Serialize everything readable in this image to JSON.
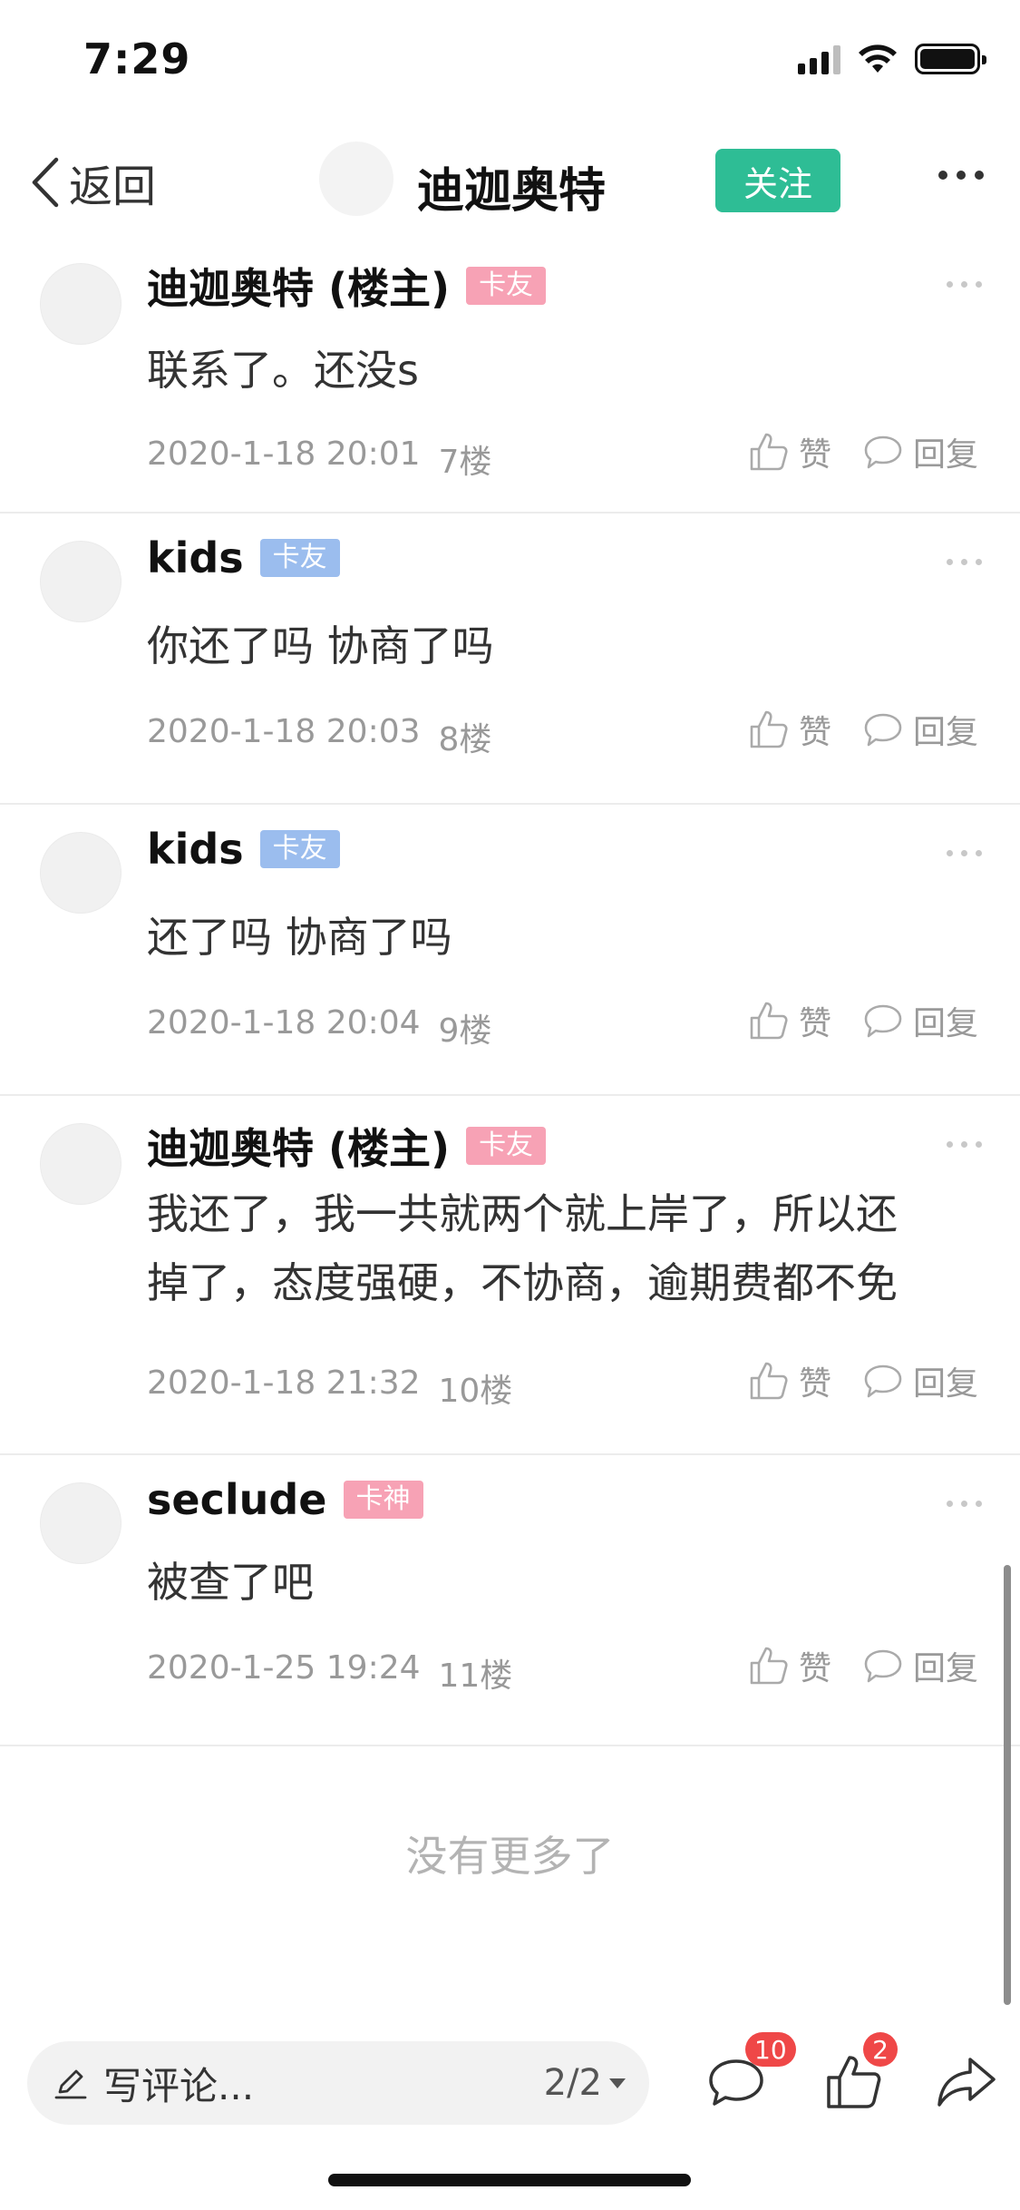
{
  "status_bar": {
    "time": "7:29"
  },
  "nav": {
    "back_label": "返回",
    "title": "迪迦奥特",
    "follow_label": "关注"
  },
  "comments": [
    {
      "name": "迪迦奥特 (楼主)",
      "badge": "卡友",
      "badge_color": "#f7a2b5",
      "text": "联系了。还没s",
      "date": "2020-1-18 20:01",
      "floor": "7楼",
      "like_label": "赞",
      "reply_label": "回复"
    },
    {
      "name": "kids",
      "badge": "卡友",
      "badge_color": "#9bbdee",
      "text": "你还了吗 协商了吗",
      "date": "2020-1-18 20:03",
      "floor": "8楼",
      "like_label": "赞",
      "reply_label": "回复"
    },
    {
      "name": "kids",
      "badge": "卡友",
      "badge_color": "#9bbdee",
      "text": "还了吗 协商了吗",
      "date": "2020-1-18 20:04",
      "floor": "9楼",
      "like_label": "赞",
      "reply_label": "回复"
    },
    {
      "name": "迪迦奥特 (楼主)",
      "badge": "卡友",
      "badge_color": "#f7a2b5",
      "text_line1": "我还了，我一共就两个就上岸了，所以还",
      "text_line2": "掉了，态度强硬，不协商，逾期费都不免",
      "date": "2020-1-18 21:32",
      "floor": "10楼",
      "like_label": "赞",
      "reply_label": "回复"
    },
    {
      "name": "seclude",
      "badge": "卡神",
      "badge_color": "#f7a2b5",
      "text": "被查了吧",
      "date": "2020-1-25 19:24",
      "floor": "11楼",
      "like_label": "赞",
      "reply_label": "回复"
    }
  ],
  "no_more": "没有更多了",
  "bottom_bar": {
    "placeholder": "写评论...",
    "page": "2/2",
    "comment_count": "10",
    "like_count": "2"
  },
  "colors": {
    "accent": "#2ebd95",
    "badge_red": "#ef4747"
  }
}
